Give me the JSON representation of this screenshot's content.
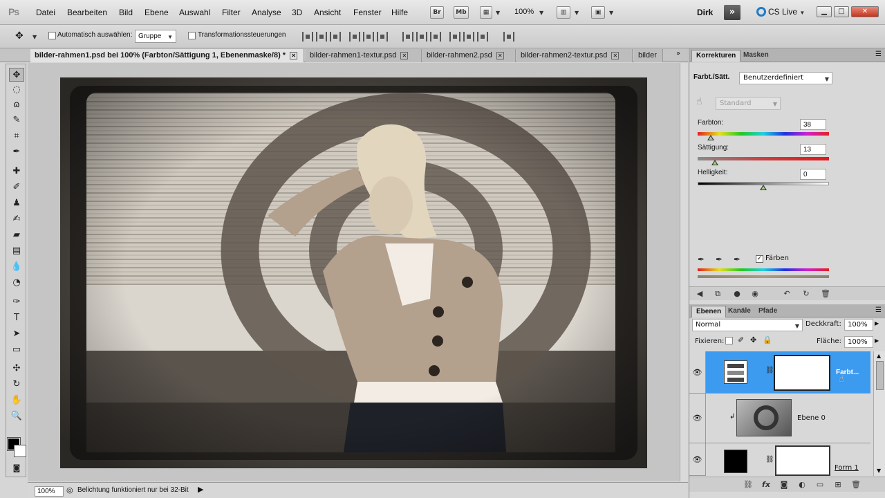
{
  "app": {
    "logo": "Ps"
  },
  "menu": {
    "items": [
      "Datei",
      "Bearbeiten",
      "Bild",
      "Ebene",
      "Auswahl",
      "Filter",
      "Analyse",
      "3D",
      "Ansicht",
      "Fenster",
      "Hilfe"
    ],
    "bridge": "Br",
    "minibridge": "Mb",
    "zoom": "100%",
    "user": "Dirk",
    "expand": "»",
    "cslive": "CS Live"
  },
  "options": {
    "auto_select_label": "Automatisch auswählen:",
    "auto_select_value": "Gruppe",
    "transform_label": "Transformationssteuerungen"
  },
  "tabs": [
    {
      "label": "bilder-rahmen1.psd bei 100% (Farbton/Sättigung 1, Ebenenmaske/8) *",
      "active": true
    },
    {
      "label": "bilder-rahmen1-textur.psd",
      "active": false
    },
    {
      "label": "bilder-rahmen2.psd",
      "active": false
    },
    {
      "label": "bilder-rahmen2-textur.psd",
      "active": false
    },
    {
      "label": "bilder",
      "active": false
    }
  ],
  "status": {
    "zoom": "100%",
    "message": "Belichtung funktioniert nur bei 32-Bit"
  },
  "corrections": {
    "tabs": [
      "Korrekturen",
      "Masken"
    ],
    "title": "Farbt./Sätt.",
    "preset": "Benutzerdefiniert",
    "channel": "Standard",
    "hue_label": "Farbton:",
    "hue_value": "38",
    "hue_level": 0.1,
    "sat_label": "Sättigung:",
    "sat_value": "13",
    "sat_level": 0.13,
    "light_label": "Helligkeit:",
    "light_value": "0",
    "light_level": 0.5,
    "colorize_label": "Färben",
    "colorize_checked": "✓"
  },
  "layers": {
    "tabs": [
      "Ebenen",
      "Kanäle",
      "Pfade"
    ],
    "blend_mode": "Normal",
    "opacity_label": "Deckkraft:",
    "opacity": "100%",
    "lock_label": "Fixieren:",
    "fill_label": "Fläche:",
    "fill": "100%",
    "rows": [
      {
        "name": "Farbt...",
        "selected": true
      },
      {
        "name": "Ebene 0",
        "selected": false
      },
      {
        "name": "Form 1",
        "selected": false
      }
    ]
  },
  "colors": {
    "selection": "#3d9bef",
    "accent": "#1e7bc8"
  }
}
